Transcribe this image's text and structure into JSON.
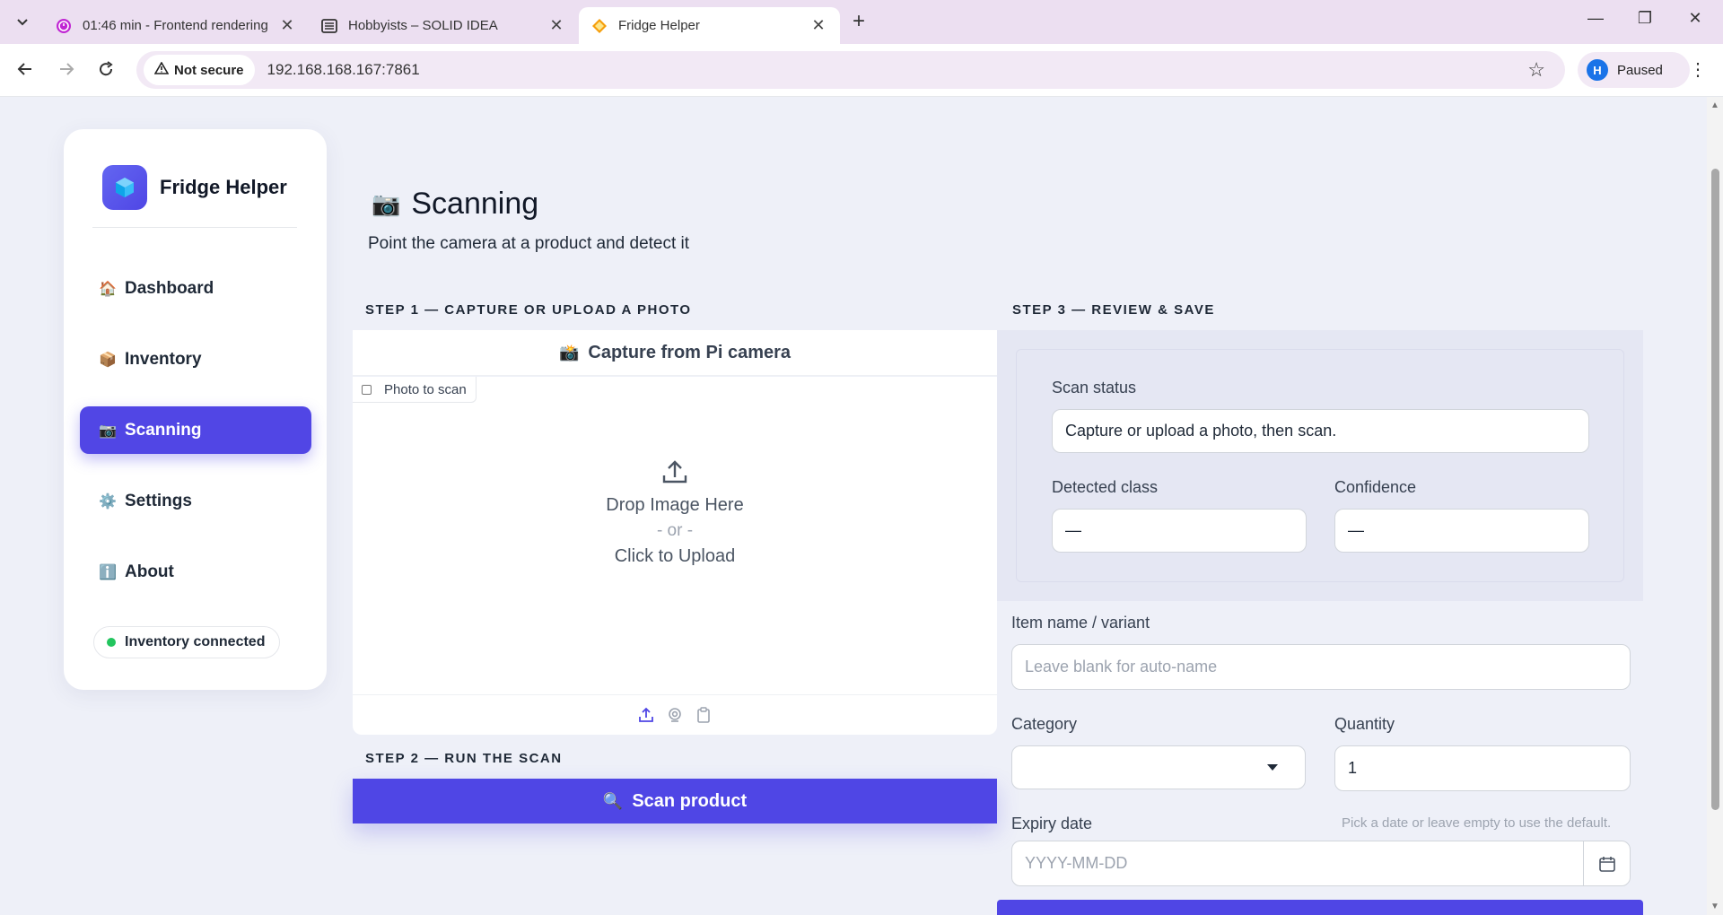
{
  "browser": {
    "tabs": [
      {
        "title": "01:46 min - Frontend rendering",
        "favicon": "timer-icon"
      },
      {
        "title": "Hobbyists – SOLID IDEA",
        "favicon": "keyboard-icon"
      },
      {
        "title": "Fridge Helper",
        "favicon": "cube-icon",
        "active": true
      }
    ],
    "security_label": "Not secure",
    "url": "192.168.168.167:7861",
    "profile_initial": "H",
    "profile_status": "Paused"
  },
  "sidebar": {
    "brand": "Fridge Helper",
    "items": [
      {
        "icon": "🏠",
        "label": "Dashboard"
      },
      {
        "icon": "📦",
        "label": "Inventory"
      },
      {
        "icon": "📷",
        "label": "Scanning",
        "active": true
      },
      {
        "icon": "⚙️",
        "label": "Settings"
      },
      {
        "icon": "ℹ️",
        "label": "About"
      }
    ],
    "status": "Inventory connected"
  },
  "main": {
    "title_icon": "📷",
    "title": "Scanning",
    "subtitle": "Point the camera at a product and detect it",
    "step1": {
      "label": "STEP 1 — CAPTURE OR UPLOAD A PHOTO",
      "capture_icon": "📸",
      "capture_label": "Capture from Pi camera",
      "upload_tag": "Photo to scan",
      "drop_line1": "Drop Image Here",
      "drop_or": "- or -",
      "drop_line2": "Click to Upload"
    },
    "step2": {
      "label": "STEP 2 — RUN THE SCAN",
      "scan_icon": "🔍",
      "scan_label": "Scan product"
    },
    "step3": {
      "label": "STEP 3 — REVIEW & SAVE",
      "scan_status_label": "Scan status",
      "scan_status_value": "Capture or upload a photo, then scan.",
      "detected_class_label": "Detected class",
      "detected_class_value": "—",
      "confidence_label": "Confidence",
      "confidence_value": "—",
      "item_name_label": "Item name / variant",
      "item_name_placeholder": "Leave blank for auto-name",
      "category_label": "Category",
      "category_value": "",
      "quantity_label": "Quantity",
      "quantity_value": "1",
      "expiry_label": "Expiry date",
      "expiry_hint": "Pick a date or leave empty to use the default.",
      "expiry_placeholder": "YYYY-MM-DD"
    }
  },
  "colors": {
    "accent": "#4f46e5",
    "status_ok": "#22c55e",
    "page_bg": "#eef0f8"
  }
}
